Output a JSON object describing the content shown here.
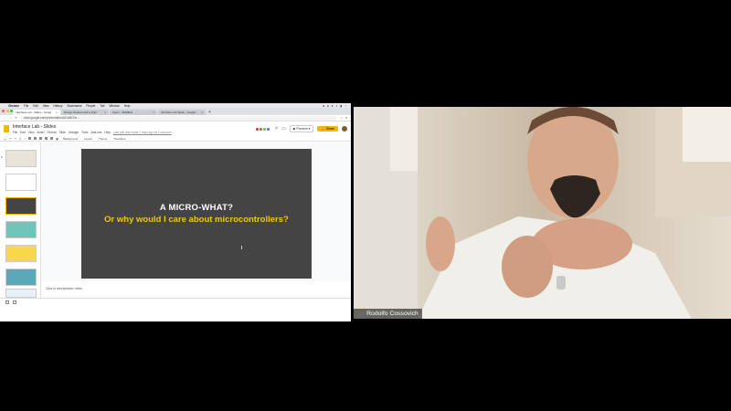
{
  "colors": {
    "accent_yellow": "#f4b400",
    "slide_bg": "#444444",
    "slide_subtitle": "#f4c31a",
    "signal_red": "#e53935"
  },
  "mac_menubar": {
    "app": "Chrome",
    "items": [
      "File",
      "Edit",
      "View",
      "History",
      "Bookmarks",
      "People",
      "Tab",
      "Window",
      "Help"
    ]
  },
  "browser": {
    "tabs": [
      {
        "label": "Interface Lab - Slides - Googl",
        "active": true
      },
      {
        "label": "Design Student and e-Prjct",
        "active": false
      },
      {
        "label": "Zoom - WiFiBLE",
        "active": false
      },
      {
        "label": "Interface Lab Week - Google",
        "active": false
      }
    ],
    "url": "docs.google.com/presentation/d/1ABO2e..."
  },
  "slides_app": {
    "title": "Interface Lab - Slides",
    "menu": [
      "File",
      "Edit",
      "View",
      "Insert",
      "Format",
      "Slide",
      "Arrange",
      "Tools",
      "Add-ons",
      "Help"
    ],
    "last_edit": "Last edit was made 2 days ago by Cossovich",
    "present_label": "Present",
    "share_label": "Share",
    "toolbar_labels": [
      "Background",
      "Layout",
      "Theme",
      "Transition"
    ],
    "notes_placeholder": "Click to add speaker notes"
  },
  "slide": {
    "title": "A MICRO-WHAT?",
    "subtitle": "Or why would I care about microcontrollers?"
  },
  "dock_icons": [
    "finder-icon",
    "launchpad-icon",
    "safari-icon",
    "mail-icon",
    "calendar-icon",
    "notes-icon",
    "reminders-icon",
    "terminal-icon",
    "slack-icon",
    "photos-icon",
    "messages-icon",
    "facetime-icon",
    "music-icon",
    "chrome-icon",
    "discord-icon",
    "zoom-icon",
    "arduino-icon",
    "vscode-icon",
    "preview-icon",
    "trash-icon"
  ],
  "video": {
    "speaker_name": "Rodolfo Cossovich"
  }
}
